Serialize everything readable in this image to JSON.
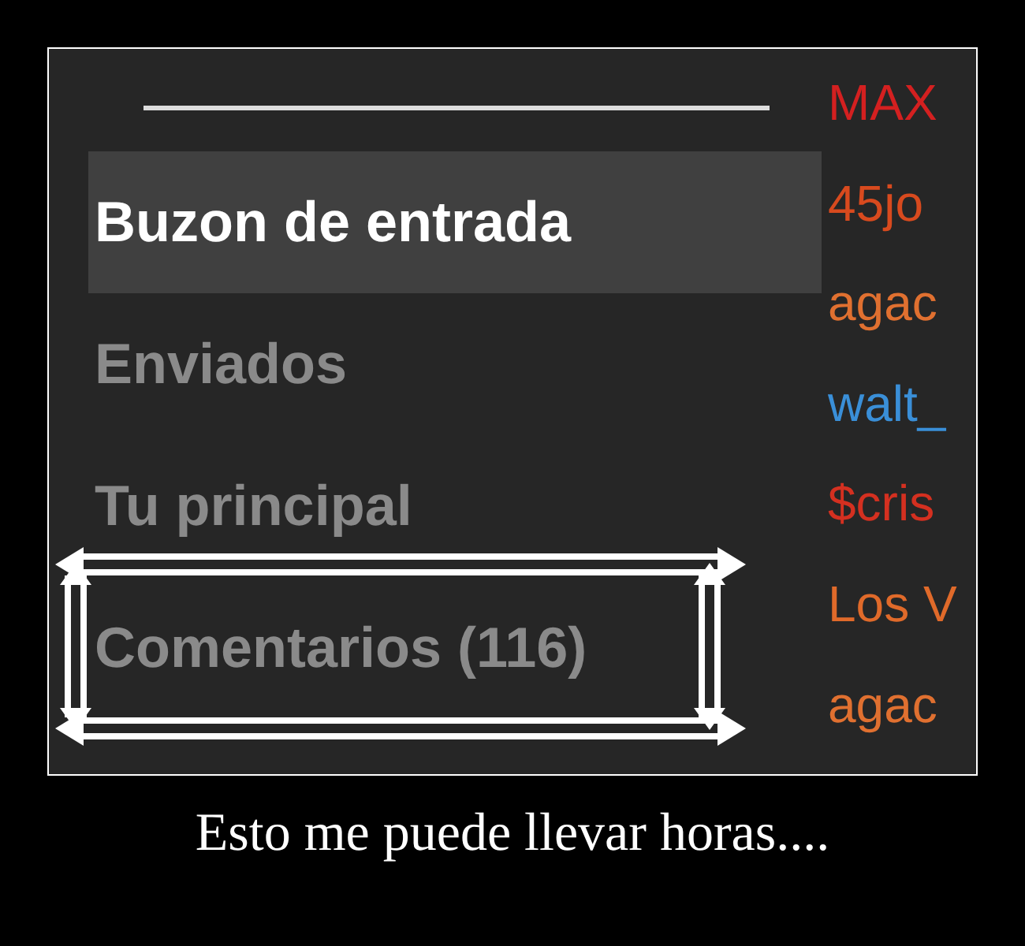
{
  "menu": {
    "items": [
      {
        "label": "Buzon de entrada",
        "selected": true
      },
      {
        "label": "Enviados",
        "selected": false
      },
      {
        "label": "Tu principal",
        "selected": false
      },
      {
        "label": "Comentarios (116)",
        "selected": false
      }
    ]
  },
  "users": [
    {
      "name": "MAX",
      "color": "#d42020"
    },
    {
      "name": "45jo",
      "color": "#d84a1e"
    },
    {
      "name": "agac",
      "color": "#e07030"
    },
    {
      "name": "walt_",
      "color": "#3a8fd8"
    },
    {
      "name": "$cris",
      "color": "#d43020"
    },
    {
      "name": "Los V",
      "color": "#e06a2a"
    },
    {
      "name": "agac",
      "color": "#e07030"
    }
  ],
  "caption": "Esto me puede llevar horas...."
}
